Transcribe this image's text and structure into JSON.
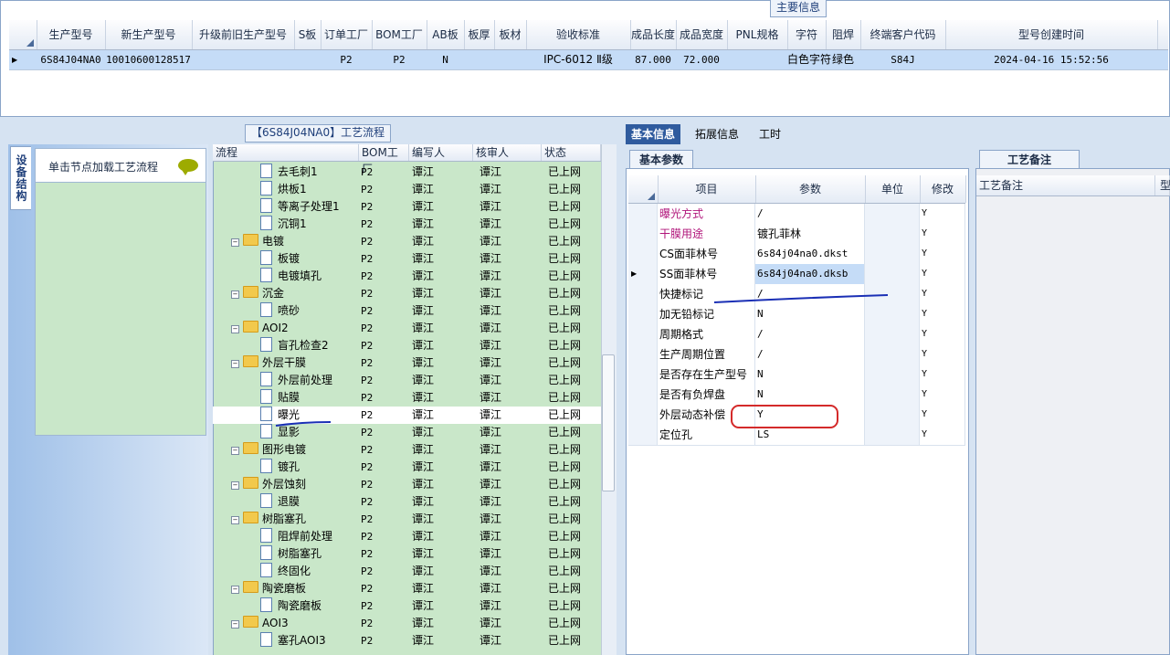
{
  "top_panel": {
    "title": "主要信息",
    "columns": [
      "生产型号",
      "新生产型号",
      "升级前旧生产型号",
      "S板",
      "订单工厂",
      "BOM工厂",
      "AB板",
      "板厚",
      "板材",
      "验收标准",
      "成品长度",
      "成品宽度",
      "PNL规格",
      "字符",
      "阻焊",
      "终端客户代码",
      "型号创建时间"
    ],
    "row": [
      "6S84J04NA0",
      "10010600128517",
      "",
      "",
      "P2",
      "P2",
      "N",
      "",
      "",
      "IPC-6012 Ⅱ级",
      "87.000",
      "72.000",
      "",
      "白色字符",
      "绿色",
      "S84J",
      "2024-04-16 15:52:56"
    ]
  },
  "sidebar": {
    "tab_label": "设备结构",
    "load_button": "单击节点加载工艺流程"
  },
  "process_panel": {
    "title": "【6S84J04NA0】工艺流程",
    "columns": [
      "流程",
      "BOM工厂",
      "编写人",
      "核审人",
      "状态"
    ],
    "rows": [
      {
        "name": "去毛刺1",
        "type": "doc",
        "bom": "P2",
        "writer": "谭江",
        "reviewer": "谭江",
        "status": "已上网"
      },
      {
        "name": "烘板1",
        "type": "doc",
        "bom": "P2",
        "writer": "谭江",
        "reviewer": "谭江",
        "status": "已上网"
      },
      {
        "name": "等离子处理1",
        "type": "doc",
        "bom": "P2",
        "writer": "谭江",
        "reviewer": "谭江",
        "status": "已上网"
      },
      {
        "name": "沉铜1",
        "type": "doc",
        "bom": "P2",
        "writer": "谭江",
        "reviewer": "谭江",
        "status": "已上网"
      },
      {
        "name": "电镀",
        "type": "folder",
        "bom": "P2",
        "writer": "谭江",
        "reviewer": "谭江",
        "status": "已上网"
      },
      {
        "name": "板镀",
        "type": "doc",
        "bom": "P2",
        "writer": "谭江",
        "reviewer": "谭江",
        "status": "已上网"
      },
      {
        "name": "电镀填孔",
        "type": "doc",
        "bom": "P2",
        "writer": "谭江",
        "reviewer": "谭江",
        "status": "已上网"
      },
      {
        "name": "沉金",
        "type": "folder",
        "bom": "P2",
        "writer": "谭江",
        "reviewer": "谭江",
        "status": "已上网"
      },
      {
        "name": "喷砂",
        "type": "doc",
        "bom": "P2",
        "writer": "谭江",
        "reviewer": "谭江",
        "status": "已上网"
      },
      {
        "name": "AOI2",
        "type": "folder",
        "bom": "P2",
        "writer": "谭江",
        "reviewer": "谭江",
        "status": "已上网"
      },
      {
        "name": "盲孔检查2",
        "type": "doc",
        "bom": "P2",
        "writer": "谭江",
        "reviewer": "谭江",
        "status": "已上网"
      },
      {
        "name": "外层干膜",
        "type": "folder",
        "bom": "P2",
        "writer": "谭江",
        "reviewer": "谭江",
        "status": "已上网"
      },
      {
        "name": "外层前处理",
        "type": "doc",
        "bom": "P2",
        "writer": "谭江",
        "reviewer": "谭江",
        "status": "已上网"
      },
      {
        "name": "贴膜",
        "type": "doc",
        "bom": "P2",
        "writer": "谭江",
        "reviewer": "谭江",
        "status": "已上网"
      },
      {
        "name": "曝光",
        "type": "doc",
        "bom": "P2",
        "writer": "谭江",
        "reviewer": "谭江",
        "status": "已上网"
      },
      {
        "name": "显影",
        "type": "doc",
        "bom": "P2",
        "writer": "谭江",
        "reviewer": "谭江",
        "status": "已上网"
      },
      {
        "name": "图形电镀",
        "type": "folder",
        "bom": "P2",
        "writer": "谭江",
        "reviewer": "谭江",
        "status": "已上网"
      },
      {
        "name": "镀孔",
        "type": "doc",
        "bom": "P2",
        "writer": "谭江",
        "reviewer": "谭江",
        "status": "已上网"
      },
      {
        "name": "外层蚀刻",
        "type": "folder",
        "bom": "P2",
        "writer": "谭江",
        "reviewer": "谭江",
        "status": "已上网"
      },
      {
        "name": "退膜",
        "type": "doc",
        "bom": "P2",
        "writer": "谭江",
        "reviewer": "谭江",
        "status": "已上网"
      },
      {
        "name": "树脂塞孔",
        "type": "folder",
        "bom": "P2",
        "writer": "谭江",
        "reviewer": "谭江",
        "status": "已上网"
      },
      {
        "name": "阻焊前处理",
        "type": "doc",
        "bom": "P2",
        "writer": "谭江",
        "reviewer": "谭江",
        "status": "已上网"
      },
      {
        "name": "树脂塞孔",
        "type": "doc",
        "bom": "P2",
        "writer": "谭江",
        "reviewer": "谭江",
        "status": "已上网"
      },
      {
        "name": "终固化",
        "type": "doc",
        "bom": "P2",
        "writer": "谭江",
        "reviewer": "谭江",
        "status": "已上网"
      },
      {
        "name": "陶瓷磨板",
        "type": "folder",
        "bom": "P2",
        "writer": "谭江",
        "reviewer": "谭江",
        "status": "已上网"
      },
      {
        "name": "陶瓷磨板",
        "type": "doc",
        "bom": "P2",
        "writer": "谭江",
        "reviewer": "谭江",
        "status": "已上网"
      },
      {
        "name": "AOI3",
        "type": "folder",
        "bom": "P2",
        "writer": "谭江",
        "reviewer": "谭江",
        "status": "已上网"
      },
      {
        "name": "塞孔AOI3",
        "type": "doc",
        "bom": "P2",
        "writer": "谭江",
        "reviewer": "谭江",
        "status": "已上网"
      }
    ]
  },
  "detail_panel": {
    "tabs": [
      "基本信息",
      "拓展信息",
      "工时"
    ],
    "subtab": "基本参数",
    "columns": [
      "项目",
      "参数",
      "单位",
      "修改"
    ],
    "rows": [
      {
        "item": "曝光方式",
        "param": "/",
        "unit": "",
        "mod": "Y",
        "highlight": true
      },
      {
        "item": "干膜用途",
        "param": "镀孔菲林",
        "unit": "",
        "mod": "Y",
        "highlight": true
      },
      {
        "item": "CS面菲林号",
        "param": "6s84j04na0.dkst",
        "unit": "",
        "mod": "Y"
      },
      {
        "item": "SS面菲林号",
        "param": "6s84j04na0.dksb",
        "unit": "",
        "mod": "Y"
      },
      {
        "item": "快捷标记",
        "param": "/",
        "unit": "",
        "mod": "Y"
      },
      {
        "item": "加无铅标记",
        "param": "N",
        "unit": "",
        "mod": "Y"
      },
      {
        "item": "周期格式",
        "param": "/",
        "unit": "",
        "mod": "Y"
      },
      {
        "item": "生产周期位置",
        "param": "/",
        "unit": "",
        "mod": "Y"
      },
      {
        "item": "是否存在生产型号",
        "param": "N",
        "unit": "",
        "mod": "Y"
      },
      {
        "item": "是否有负焊盘",
        "param": "N",
        "unit": "",
        "mod": "Y"
      },
      {
        "item": "外层动态补偿",
        "param": "Y",
        "unit": "",
        "mod": "Y"
      },
      {
        "item": "定位孔",
        "param": "LS",
        "unit": "",
        "mod": "Y"
      }
    ]
  },
  "notes_panel": {
    "title": "工艺备注",
    "columns": [
      "工艺备注",
      "型"
    ]
  }
}
